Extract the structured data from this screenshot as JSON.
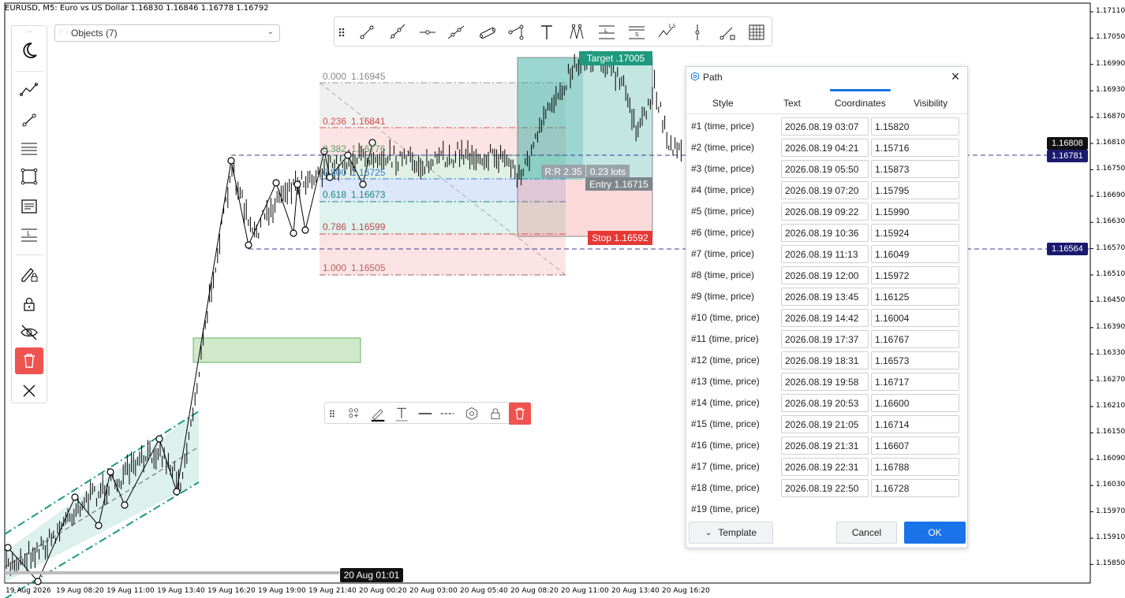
{
  "chart": {
    "symbol_line": "EURUSD, M5:  Euro vs US Dollar  1.16830 1.16846 1.16778 1.16792",
    "price_ticks": [
      "1.17110",
      "1.17050",
      "1.16990",
      "1.16930",
      "1.16870",
      "1.16810",
      "1.16750",
      "1.16690",
      "1.16630",
      "1.16570",
      "1.16510",
      "1.16450",
      "1.16390",
      "1.16330",
      "1.16270",
      "1.16210",
      "1.16150",
      "1.16090",
      "1.16030",
      "1.15970",
      "1.15910",
      "1.15850"
    ],
    "time_ticks": [
      "19 Aug 2026",
      "19 Aug 08:20",
      "19 Aug 11:00",
      "19 Aug 13:40",
      "19 Aug 16:20",
      "19 Aug 19:00",
      "19 Aug 21:40",
      "20 Aug 00:20",
      "20 Aug 03:00",
      "20 Aug 05:40",
      "20 Aug 08:20",
      "20 Aug 11:00",
      "20 Aug 13:40",
      "20 Aug 16:20"
    ],
    "crosshair_time": "20 Aug 01:01",
    "badges": {
      "last_price": "1.16808",
      "line1": "1.16781",
      "line2": "1.16564"
    },
    "fib_levels": [
      {
        "ratio": "0.000",
        "price": "1.16945",
        "color": "#888888"
      },
      {
        "ratio": "0.236",
        "price": "1.16841",
        "color": "#d94a4a"
      },
      {
        "ratio": "0.382",
        "price": "1.16776",
        "color": "#5a9a6a"
      },
      {
        "ratio": "0.500",
        "price": "1.16725",
        "color": "#3a7bd5"
      },
      {
        "ratio": "0.618",
        "price": "1.16673",
        "color": "#1a8a7a"
      },
      {
        "ratio": "0.786",
        "price": "1.16599",
        "color": "#c04545"
      },
      {
        "ratio": "1.000",
        "price": "1.16505",
        "color": "#b06060"
      }
    ],
    "position_tool": {
      "target": "Target .17005",
      "rr": "R:R 2.35",
      "lots": "0.23 lots",
      "entry": "Entry 1.16715",
      "stop": "Stop 1.16592"
    },
    "colors": {
      "target_green": "#26a69a",
      "stop_red": "#ef5350",
      "badge_navy": "#1a1a6e",
      "badge_black": "#111111"
    }
  },
  "objects_dropdown": {
    "label": "Objects (7)"
  },
  "left_toolbar": {
    "icons": [
      "moon-icon",
      "trend-line-icon",
      "ray-icon",
      "channel-icon",
      "rectangle-icon",
      "text-block-icon",
      "level-icon",
      "edit-lock-icon",
      "lock-icon",
      "hide-icon",
      "trash-icon",
      "close-icon"
    ]
  },
  "top_toolbar": {
    "icons": [
      "grip-icon",
      "trend-line-icon",
      "ray-line-icon",
      "horizontal-ray-icon",
      "extended-line-icon",
      "parallel-channel-icon",
      "path-icon",
      "text-icon",
      "pitchfork-icon",
      "fibonacci-icon",
      "gann-icon",
      "elliott-wave-icon",
      "vertical-line-icon",
      "brush-icon",
      "grid-icon"
    ]
  },
  "object_toolbar": {
    "icons": [
      "grip-icon",
      "add-objects-icon",
      "line-color-icon",
      "text-style-icon",
      "line-width-icon",
      "line-style-icon",
      "settings-icon",
      "lock-icon",
      "trash-icon"
    ]
  },
  "dialog": {
    "title": "Path",
    "close": "×",
    "tabs": [
      "Style",
      "Text",
      "Coordinates",
      "Visibility"
    ],
    "active_tab": "Coordinates",
    "rows": [
      {
        "label": "#1  (time, price)",
        "time": "2026.08.19 03:07",
        "price": "1.15820"
      },
      {
        "label": "#2  (time, price)",
        "time": "2026.08.19 04:21",
        "price": "1.15716"
      },
      {
        "label": "#3  (time, price)",
        "time": "2026.08.19 05:50",
        "price": "1.15873"
      },
      {
        "label": "#4  (time, price)",
        "time": "2026.08.19 07:20",
        "price": "1.15795"
      },
      {
        "label": "#5  (time, price)",
        "time": "2026.08.19 09:22",
        "price": "1.15990"
      },
      {
        "label": "#6  (time, price)",
        "time": "2026.08.19 10:36",
        "price": "1.15924"
      },
      {
        "label": "#7  (time, price)",
        "time": "2026.08.19 11:13",
        "price": "1.16049"
      },
      {
        "label": "#8  (time, price)",
        "time": "2026.08.19 12:00",
        "price": "1.15972"
      },
      {
        "label": "#9  (time, price)",
        "time": "2026.08.19 13:45",
        "price": "1.16125"
      },
      {
        "label": "#10  (time, price)",
        "time": "2026.08.19 14:42",
        "price": "1.16004"
      },
      {
        "label": "#11  (time, price)",
        "time": "2026.08.19 17:37",
        "price": "1.16767"
      },
      {
        "label": "#12  (time, price)",
        "time": "2026.08.19 18:31",
        "price": "1.16573"
      },
      {
        "label": "#13  (time, price)",
        "time": "2026.08.19 19:58",
        "price": "1.16717"
      },
      {
        "label": "#14  (time, price)",
        "time": "2026.08.19 20:53",
        "price": "1.16600"
      },
      {
        "label": "#15  (time, price)",
        "time": "2026.08.19 21:05",
        "price": "1.16714"
      },
      {
        "label": "#16  (time, price)",
        "time": "2026.08.19 21:31",
        "price": "1.16607"
      },
      {
        "label": "#17  (time, price)",
        "time": "2026.08.19 22:31",
        "price": "1.16788"
      },
      {
        "label": "#18  (time, price)",
        "time": "2026.08.19 22:50",
        "price": "1.16728"
      },
      {
        "label": "#19  (time, price)",
        "time": "",
        "price": ""
      }
    ],
    "template_button": "Template",
    "template_caret": "⌄",
    "cancel_button": "Cancel",
    "ok_button": "OK"
  }
}
